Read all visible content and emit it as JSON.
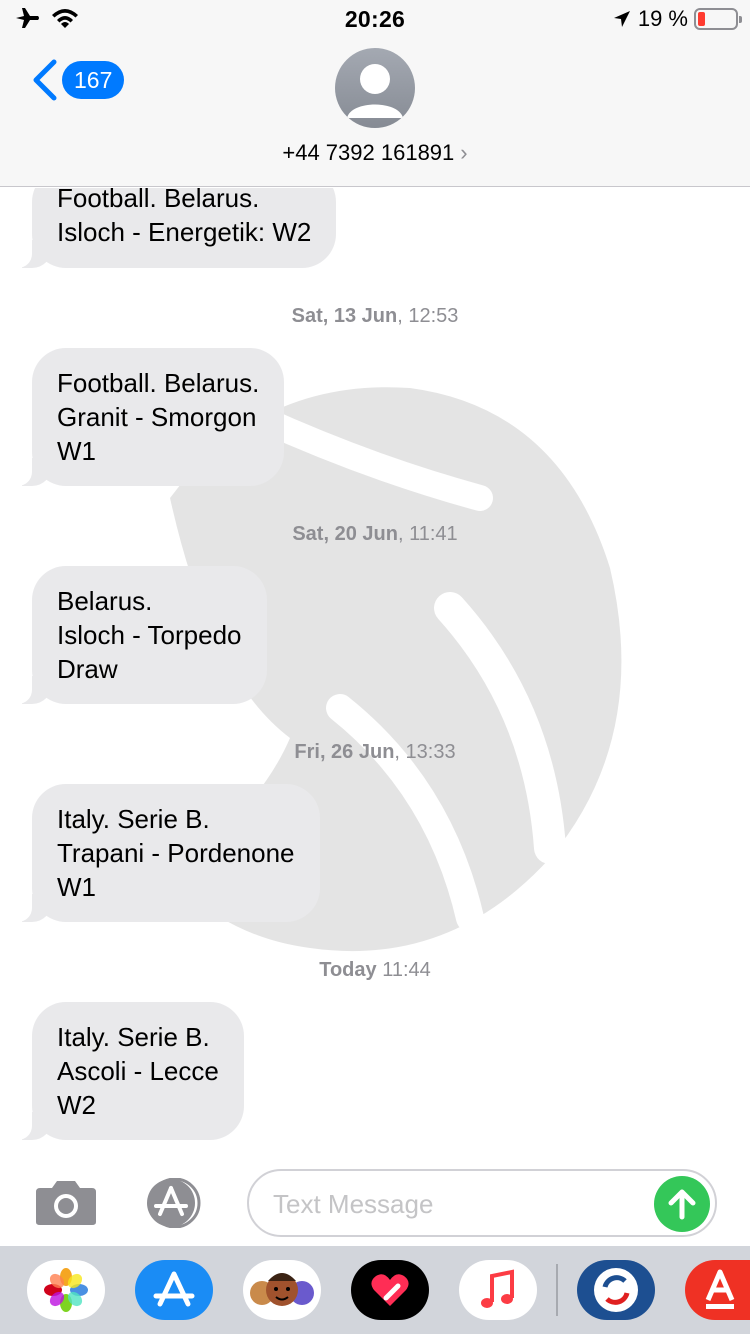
{
  "status_bar": {
    "time": "20:26",
    "battery_percent": "19 %",
    "battery_level": 0.19,
    "icons": [
      "airplane-icon",
      "wifi-icon",
      "location-arrow-icon",
      "battery-icon"
    ]
  },
  "header": {
    "back_badge": "167",
    "contact": "+44 7392 161891"
  },
  "messages": [
    {
      "lines": [
        "Football. Belarus.",
        "Isloch - Energetik: W2"
      ]
    },
    {
      "timestamp_day": "Sat, 13 Jun",
      "timestamp_time": ", 12:53",
      "lines": [
        "Football. Belarus.",
        "Granit - Smorgon",
        "W1"
      ]
    },
    {
      "timestamp_day": "Sat, 20 Jun",
      "timestamp_time": ", 11:41",
      "lines": [
        "Belarus.",
        "Isloch - Torpedo",
        "Draw"
      ]
    },
    {
      "timestamp_day": "Fri, 26 Jun",
      "timestamp_time": ", 13:33",
      "lines": [
        "Italy. Serie B.",
        "Trapani - Pordenone",
        "W1"
      ]
    },
    {
      "timestamp_day": "Today",
      "timestamp_time": " 11:44",
      "lines": [
        "Italy. Serie B.",
        "Ascoli - Lecce",
        "W2"
      ]
    }
  ],
  "input": {
    "placeholder": "Text Message",
    "value": ""
  },
  "app_drawer": {
    "apps": [
      "photos-app-icon",
      "app-store-app-icon",
      "memoji-app-icon",
      "digital-touch-app-icon",
      "music-app-icon",
      "sync-app-icon",
      "alfa-bank-app-icon"
    ]
  },
  "colors": {
    "accent": "#007aff",
    "bubble": "#e9e9eb",
    "send": "#34c759",
    "battery_low": "#ff3b30"
  }
}
